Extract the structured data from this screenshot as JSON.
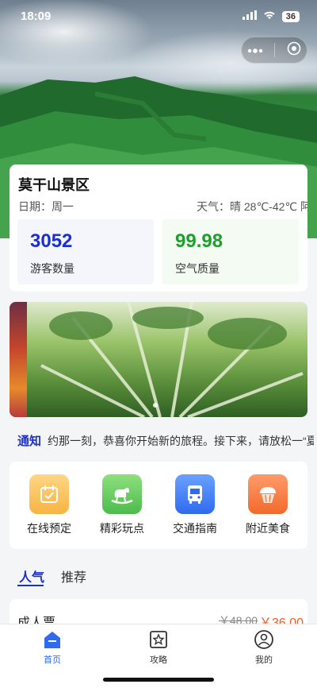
{
  "status_bar": {
    "time": "18:09",
    "battery": "36"
  },
  "scenic": {
    "name": "莫干山景区",
    "date_label": "日期：周一",
    "weather_label": "天气：晴 28℃-42℃ 阿"
  },
  "stats": {
    "visitors_value": "3052",
    "visitors_label": "游客数量",
    "air_value": "99.98",
    "air_label": "空气质量"
  },
  "notice": {
    "title": "通知",
    "text": "约那一刻，恭喜你开始新的旅程。接下来，请放松一“夏"
  },
  "quick_menu": [
    {
      "label": "在线预定",
      "icon": "calendar-check-icon"
    },
    {
      "label": "精彩玩点",
      "icon": "rocking-horse-icon"
    },
    {
      "label": "交通指南",
      "icon": "bus-icon"
    },
    {
      "label": "附近美食",
      "icon": "cupcake-icon"
    }
  ],
  "tabs": {
    "hot": "人气",
    "recommend": "推荐"
  },
  "ticket": {
    "name": "成人票",
    "old_price": "￥48.00",
    "price": "￥36.00"
  },
  "tabbar": [
    {
      "label": "首页",
      "icon": "home-icon",
      "active": true
    },
    {
      "label": "攻略",
      "icon": "star-frame-icon",
      "active": false
    },
    {
      "label": "我的",
      "icon": "user-icon",
      "active": false
    }
  ],
  "colors": {
    "accent": "#1a2fd0",
    "air_green": "#1e9e2a",
    "price_orange": "#f15a24",
    "tab_active": "#2f6af0"
  }
}
